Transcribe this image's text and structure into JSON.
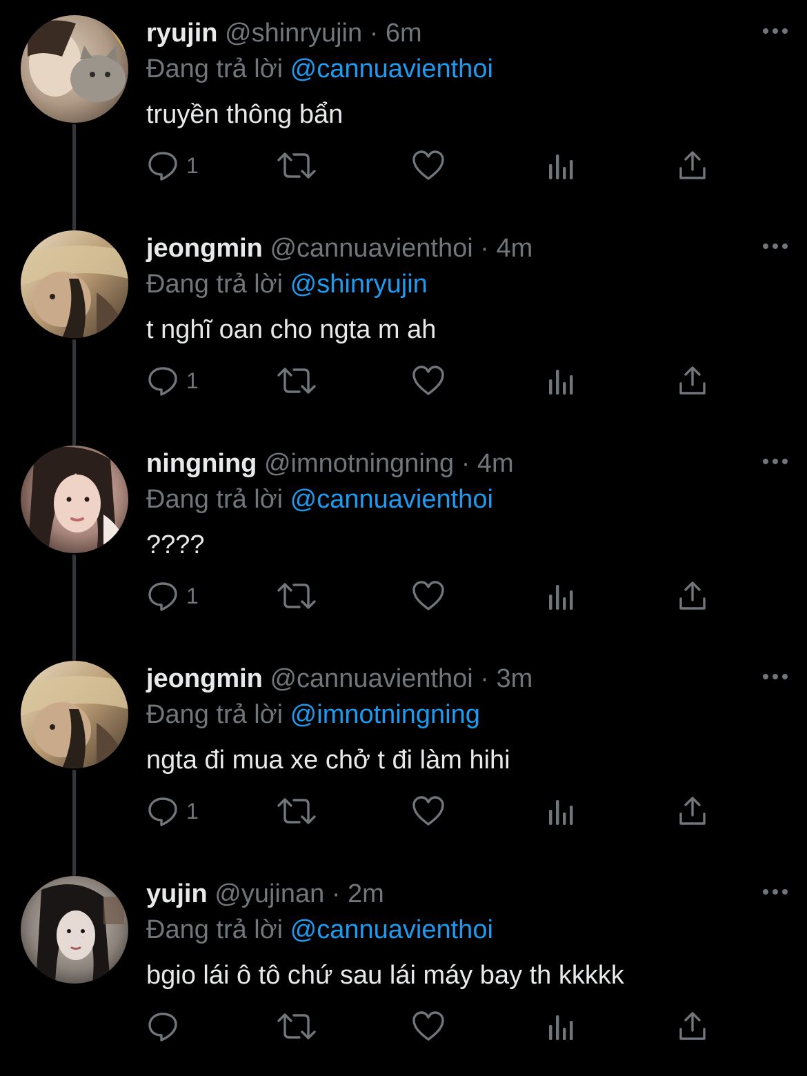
{
  "colors": {
    "background": "#000000",
    "text_primary": "#e7e9ea",
    "text_secondary": "#71767b",
    "mention": "#1d9bf0",
    "thread_line": "#333639"
  },
  "tweets": [
    {
      "name": "ryujin",
      "handle": "@shinryujin",
      "dot": "·",
      "time": "6m",
      "replying_label": "Đang trả lời",
      "replying_to": "@cannuavienthoi",
      "text": "truyền thông bẩn",
      "reply_count": "1",
      "avatar_icon": "cat-selfie-avatar"
    },
    {
      "name": "jeongmin",
      "handle": "@cannuavienthoi",
      "dot": "·",
      "time": "4m",
      "replying_label": "Đang trả lời",
      "replying_to": "@shinryujin",
      "text": "t nghĩ oan cho ngta m ah",
      "reply_count": "1",
      "avatar_icon": "blonde-selfie-avatar"
    },
    {
      "name": "ningning",
      "handle": "@imnotningning",
      "dot": "·",
      "time": "4m",
      "replying_label": "Đang trả lời",
      "replying_to": "@cannuavienthoi",
      "text": "????",
      "reply_count": "1",
      "avatar_icon": "portrait-avatar"
    },
    {
      "name": "jeongmin",
      "handle": "@cannuavienthoi",
      "dot": "·",
      "time": "3m",
      "replying_label": "Đang trả lời",
      "replying_to": "@imnotningning",
      "text": "ngta đi mua xe chở t đi làm hihi",
      "reply_count": "1",
      "avatar_icon": "blonde-selfie-avatar"
    },
    {
      "name": "yujin",
      "handle": "@yujinan",
      "dot": "·",
      "time": "2m",
      "replying_label": "Đang trả lời",
      "replying_to": "@cannuavienthoi",
      "text": "bgio lái ô tô chứ sau lái máy bay th kkkkk",
      "reply_count": "",
      "avatar_icon": "portrait-avatar"
    }
  ]
}
